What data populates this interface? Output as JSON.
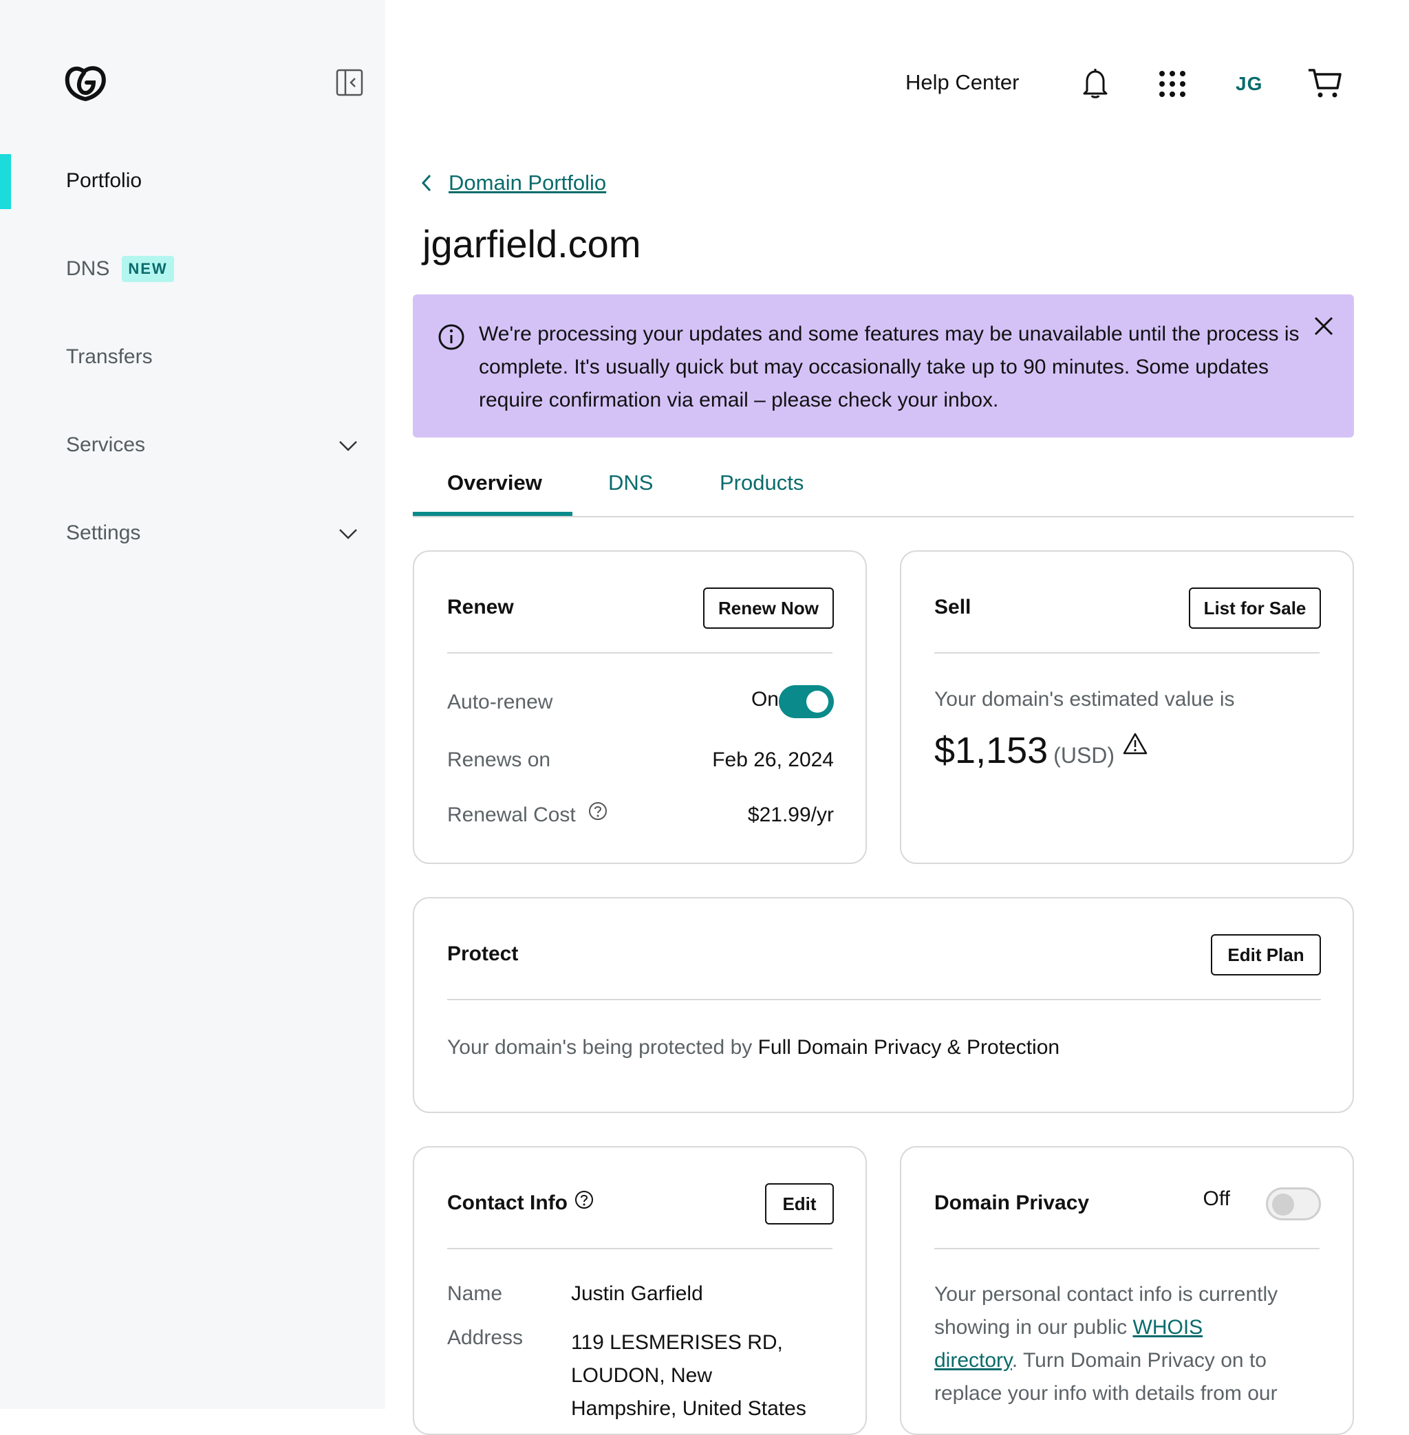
{
  "sidebar": {
    "items": [
      {
        "label": "Portfolio"
      },
      {
        "label": "DNS",
        "badge": "NEW"
      },
      {
        "label": "Transfers"
      },
      {
        "label": "Services"
      },
      {
        "label": "Settings"
      }
    ]
  },
  "topbar": {
    "help_label": "Help Center",
    "avatar_initials": "JG"
  },
  "breadcrumb": {
    "label": "Domain Portfolio"
  },
  "page_title": "jgarfield.com",
  "alert": {
    "message": "We're processing your updates and some features may be unavailable until the process is complete. It's usually quick but may occasionally take up to 90 minutes. Some updates require confirmation via email – please check your inbox."
  },
  "tabs": [
    {
      "label": "Overview",
      "active": true
    },
    {
      "label": "DNS"
    },
    {
      "label": "Products"
    }
  ],
  "renew": {
    "title": "Renew",
    "button": "Renew Now",
    "autorenew_label": "Auto-renew",
    "autorenew_state": "On",
    "renews_on_label": "Renews on",
    "renews_on_value": "Feb 26, 2024",
    "cost_label": "Renewal Cost",
    "cost_value": "$21.99/yr"
  },
  "sell": {
    "title": "Sell",
    "button": "List for Sale",
    "estimate_label": "Your domain's estimated value is",
    "amount": "$1,153",
    "currency": "(USD)"
  },
  "protect": {
    "title": "Protect",
    "button": "Edit Plan",
    "text_prefix": "Your domain's being protected by",
    "plan_name": "Full Domain Privacy & Protection"
  },
  "contact": {
    "title": "Contact Info",
    "button": "Edit",
    "name_label": "Name",
    "name_value": "Justin Garfield",
    "address_label": "Address",
    "address_line1": "119 LESMERISES RD,",
    "address_line2": "LOUDON, New",
    "address_line3": "Hampshire, United States"
  },
  "privacy": {
    "title": "Domain Privacy",
    "state": "Off",
    "text_1": "Your personal contact info is currently",
    "text_2": "showing in our public",
    "link_1": "WHOIS",
    "link_2": "directory",
    "text_3": ". Turn Domain Privacy on to",
    "text_4": "replace your info with details from our"
  },
  "colors": {
    "accent": "#0a8a8a",
    "link": "#0a6b6b",
    "alert_bg": "#d4c2f7",
    "active_indicator": "#1bdbdb",
    "badge_bg": "#b3f5ef"
  }
}
